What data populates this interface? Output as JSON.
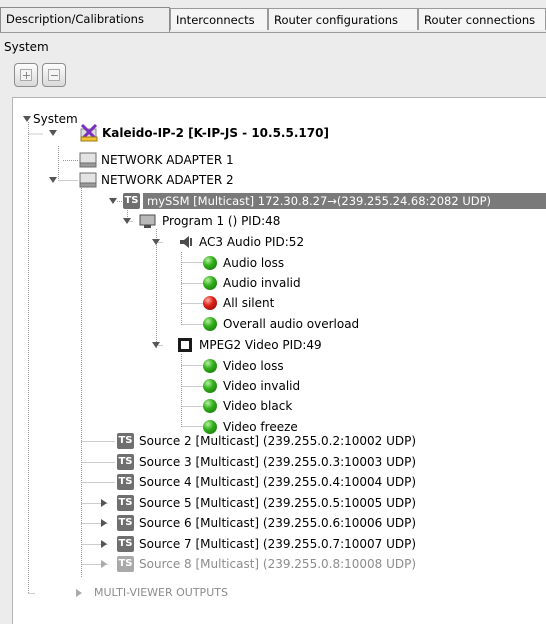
{
  "tabs": [
    {
      "label": "Description/Calibrations",
      "active": true
    },
    {
      "label": "Interconnects",
      "active": false
    },
    {
      "label": "Router configurations",
      "active": false
    },
    {
      "label": "Router connections",
      "active": false
    }
  ],
  "panel": {
    "label": "System"
  },
  "toolbar": {
    "expand_icon": "plus-icon",
    "collapse_icon": "minus-icon"
  },
  "tree": {
    "root": "System",
    "device": "Kaleido-IP-2 [K-IP-JS - 10.5.5.170]",
    "adapter1": "NETWORK ADAPTER 1",
    "adapter2": "NETWORK ADAPTER 2",
    "stream": "mySSM [Multicast] 172.30.8.27→(239.255.24.68:2082 UDP)",
    "program": "Program 1 () PID:48",
    "audio": "AC3 Audio PID:52",
    "audio_alarms": [
      {
        "label": "Audio loss",
        "status": "green"
      },
      {
        "label": "Audio invalid",
        "status": "green"
      },
      {
        "label": "All silent",
        "status": "red"
      },
      {
        "label": "Overall audio overload",
        "status": "green"
      }
    ],
    "video": "MPEG2 Video PID:49",
    "video_alarms": [
      {
        "label": "Video loss",
        "status": "green"
      },
      {
        "label": "Video invalid",
        "status": "green"
      },
      {
        "label": "Video black",
        "status": "green"
      },
      {
        "label": "Video freeze",
        "status": "green"
      }
    ],
    "sources": [
      "Source 2 [Multicast] (239.255.0.2:10002 UDP)",
      "Source 3 [Multicast] (239.255.0.3:10003 UDP)",
      "Source 4 [Multicast] (239.255.0.4:10004 UDP)",
      "Source 5 [Multicast] (239.255.0.5:10005 UDP)",
      "Source 6 [Multicast] (239.255.0.6:10006 UDP)",
      "Source 7 [Multicast] (239.255.0.7:10007 UDP)",
      "Source 8 [Multicast] (239.255.0.8:10008 UDP)"
    ],
    "ts_badge": "TS",
    "multiviewer": "MULTI-VIEWER OUTPUTS"
  },
  "colors": {
    "alarm_ok": "#33b11c",
    "alarm_fail": "#e0221a",
    "selection": "#7a7a7a"
  }
}
